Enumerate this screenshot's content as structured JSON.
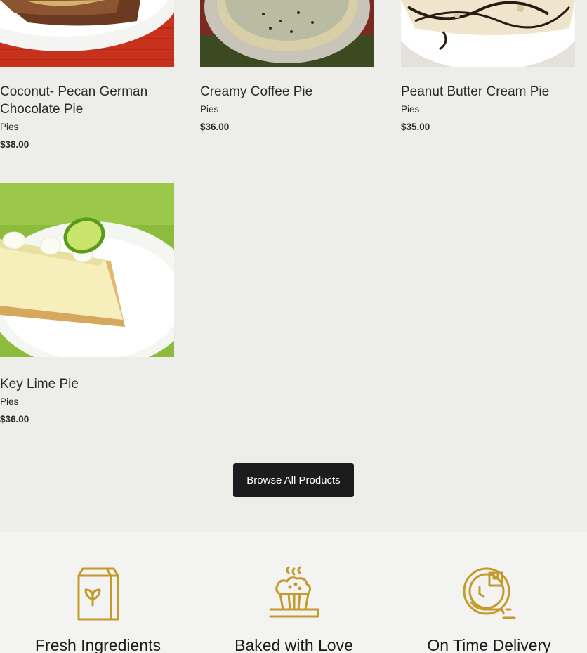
{
  "products": [
    {
      "name": "Coconut- Pecan German Chocolate Pie",
      "category": "Pies",
      "price": "$38.00",
      "image_icon": "coconut-pecan-pie-photo"
    },
    {
      "name": "Creamy Coffee Pie",
      "category": "Pies",
      "price": "$36.00",
      "image_icon": "creamy-coffee-pie-photo"
    },
    {
      "name": "Peanut Butter Cream Pie",
      "category": "Pies",
      "price": "$35.00",
      "image_icon": "peanut-butter-pie-photo"
    },
    {
      "name": "Key Lime Pie",
      "category": "Pies",
      "price": "$36.00",
      "image_icon": "key-lime-pie-photo"
    }
  ],
  "browse_label": "Browse All Products",
  "features": [
    {
      "title": "Fresh Ingredients",
      "icon": "ingredients-bag-icon"
    },
    {
      "title": "Baked with Love",
      "icon": "baked-muffin-icon"
    },
    {
      "title": "On Time Delivery",
      "icon": "delivery-clock-icon"
    }
  ],
  "colors": {
    "accent_gold": "#c49a2c",
    "button_bg": "#1c1c1c",
    "page_bg": "#edede9"
  }
}
